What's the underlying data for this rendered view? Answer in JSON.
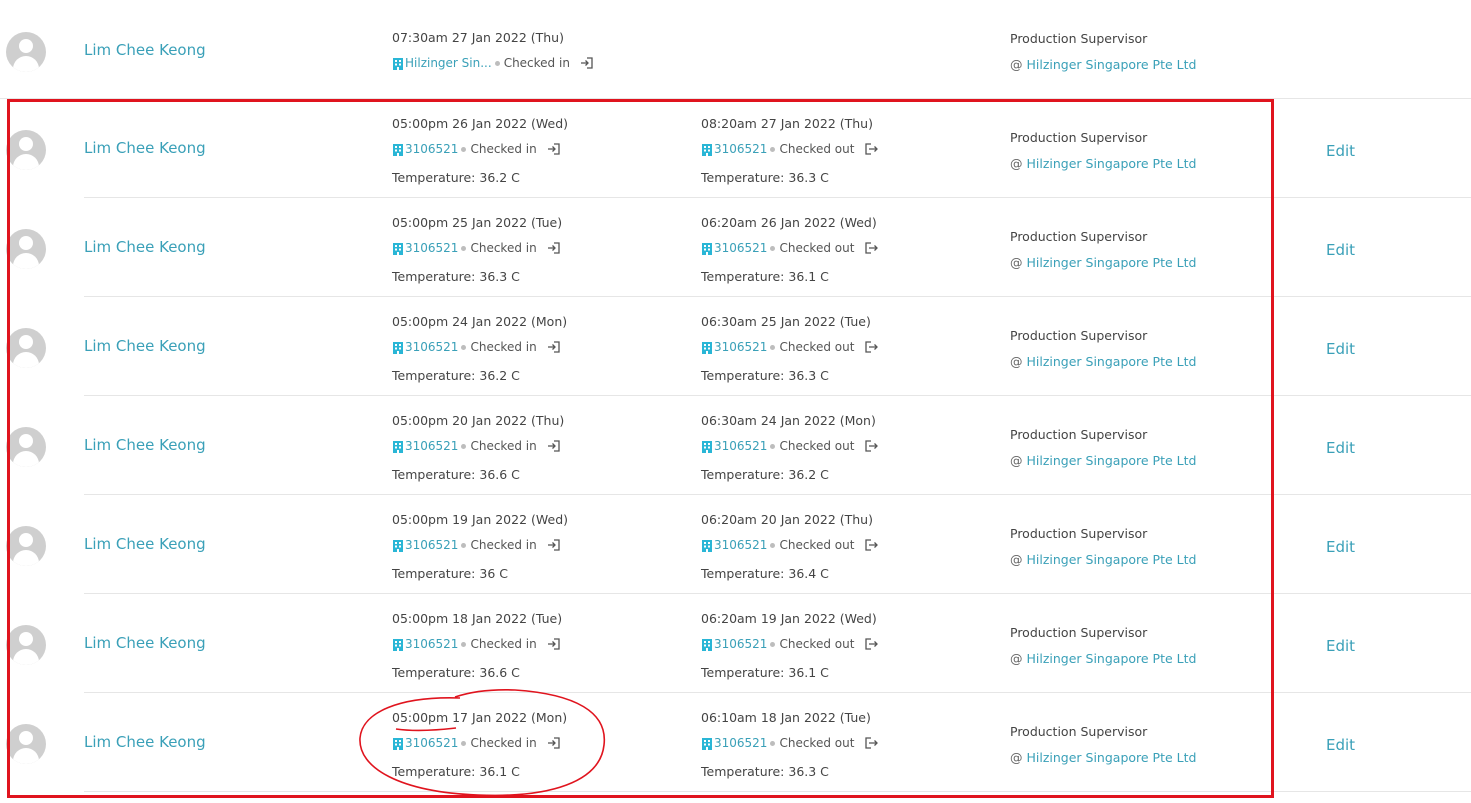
{
  "records": [
    {
      "name": "Lim Chee Keong",
      "checkin": {
        "time": "07:30am 27 Jan 2022 (Thu)",
        "location": "Hilzinger Sin...",
        "status": "Checked in",
        "temperature": null
      },
      "checkout": null,
      "role": "Production Supervisor",
      "company_prefix": "@",
      "company": "Hilzinger Singapore Pte Ltd",
      "edit": null
    },
    {
      "name": "Lim Chee Keong",
      "checkin": {
        "time": "05:00pm 26 Jan 2022 (Wed)",
        "location": "3106521",
        "status": "Checked in",
        "temperature": "Temperature: 36.2 C"
      },
      "checkout": {
        "time": "08:20am 27 Jan 2022 (Thu)",
        "location": "3106521",
        "status": "Checked out",
        "temperature": "Temperature: 36.3 C"
      },
      "role": "Production Supervisor",
      "company_prefix": "@",
      "company": "Hilzinger Singapore Pte Ltd",
      "edit": "Edit"
    },
    {
      "name": "Lim Chee Keong",
      "checkin": {
        "time": "05:00pm 25 Jan 2022 (Tue)",
        "location": "3106521",
        "status": "Checked in",
        "temperature": "Temperature: 36.3 C"
      },
      "checkout": {
        "time": "06:20am 26 Jan 2022 (Wed)",
        "location": "3106521",
        "status": "Checked out",
        "temperature": "Temperature: 36.1 C"
      },
      "role": "Production Supervisor",
      "company_prefix": "@",
      "company": "Hilzinger Singapore Pte Ltd",
      "edit": "Edit"
    },
    {
      "name": "Lim Chee Keong",
      "checkin": {
        "time": "05:00pm 24 Jan 2022 (Mon)",
        "location": "3106521",
        "status": "Checked in",
        "temperature": "Temperature: 36.2 C"
      },
      "checkout": {
        "time": "06:30am 25 Jan 2022 (Tue)",
        "location": "3106521",
        "status": "Checked out",
        "temperature": "Temperature: 36.3 C"
      },
      "role": "Production Supervisor",
      "company_prefix": "@",
      "company": "Hilzinger Singapore Pte Ltd",
      "edit": "Edit"
    },
    {
      "name": "Lim Chee Keong",
      "checkin": {
        "time": "05:00pm 20 Jan 2022 (Thu)",
        "location": "3106521",
        "status": "Checked in",
        "temperature": "Temperature: 36.6 C"
      },
      "checkout": {
        "time": "06:30am 24 Jan 2022 (Mon)",
        "location": "3106521",
        "status": "Checked out",
        "temperature": "Temperature: 36.2 C"
      },
      "role": "Production Supervisor",
      "company_prefix": "@",
      "company": "Hilzinger Singapore Pte Ltd",
      "edit": "Edit"
    },
    {
      "name": "Lim Chee Keong",
      "checkin": {
        "time": "05:00pm 19 Jan 2022 (Wed)",
        "location": "3106521",
        "status": "Checked in",
        "temperature": "Temperature: 36 C"
      },
      "checkout": {
        "time": "06:20am 20 Jan 2022 (Thu)",
        "location": "3106521",
        "status": "Checked out",
        "temperature": "Temperature: 36.4 C"
      },
      "role": "Production Supervisor",
      "company_prefix": "@",
      "company": "Hilzinger Singapore Pte Ltd",
      "edit": "Edit"
    },
    {
      "name": "Lim Chee Keong",
      "checkin": {
        "time": "05:00pm 18 Jan 2022 (Tue)",
        "location": "3106521",
        "status": "Checked in",
        "temperature": "Temperature: 36.6 C"
      },
      "checkout": {
        "time": "06:20am 19 Jan 2022 (Wed)",
        "location": "3106521",
        "status": "Checked out",
        "temperature": "Temperature: 36.1 C"
      },
      "role": "Production Supervisor",
      "company_prefix": "@",
      "company": "Hilzinger Singapore Pte Ltd",
      "edit": "Edit"
    },
    {
      "name": "Lim Chee Keong",
      "checkin": {
        "time": "05:00pm 17 Jan 2022 (Mon)",
        "location": "3106521",
        "status": "Checked in",
        "temperature": "Temperature: 36.1 C"
      },
      "checkout": {
        "time": "06:10am 18 Jan 2022 (Tue)",
        "location": "3106521",
        "status": "Checked out",
        "temperature": "Temperature: 36.3 C"
      },
      "role": "Production Supervisor",
      "company_prefix": "@",
      "company": "Hilzinger Singapore Pte Ltd",
      "edit": "Edit"
    }
  ],
  "icons": {
    "location": "building-icon",
    "checkin": "sign-in-icon",
    "checkout": "sign-out-icon",
    "avatar": "default-user-avatar"
  },
  "colors": {
    "link": "#3aa0b8",
    "annotation": "#e0141e",
    "building_icon": "#29b6d6"
  }
}
